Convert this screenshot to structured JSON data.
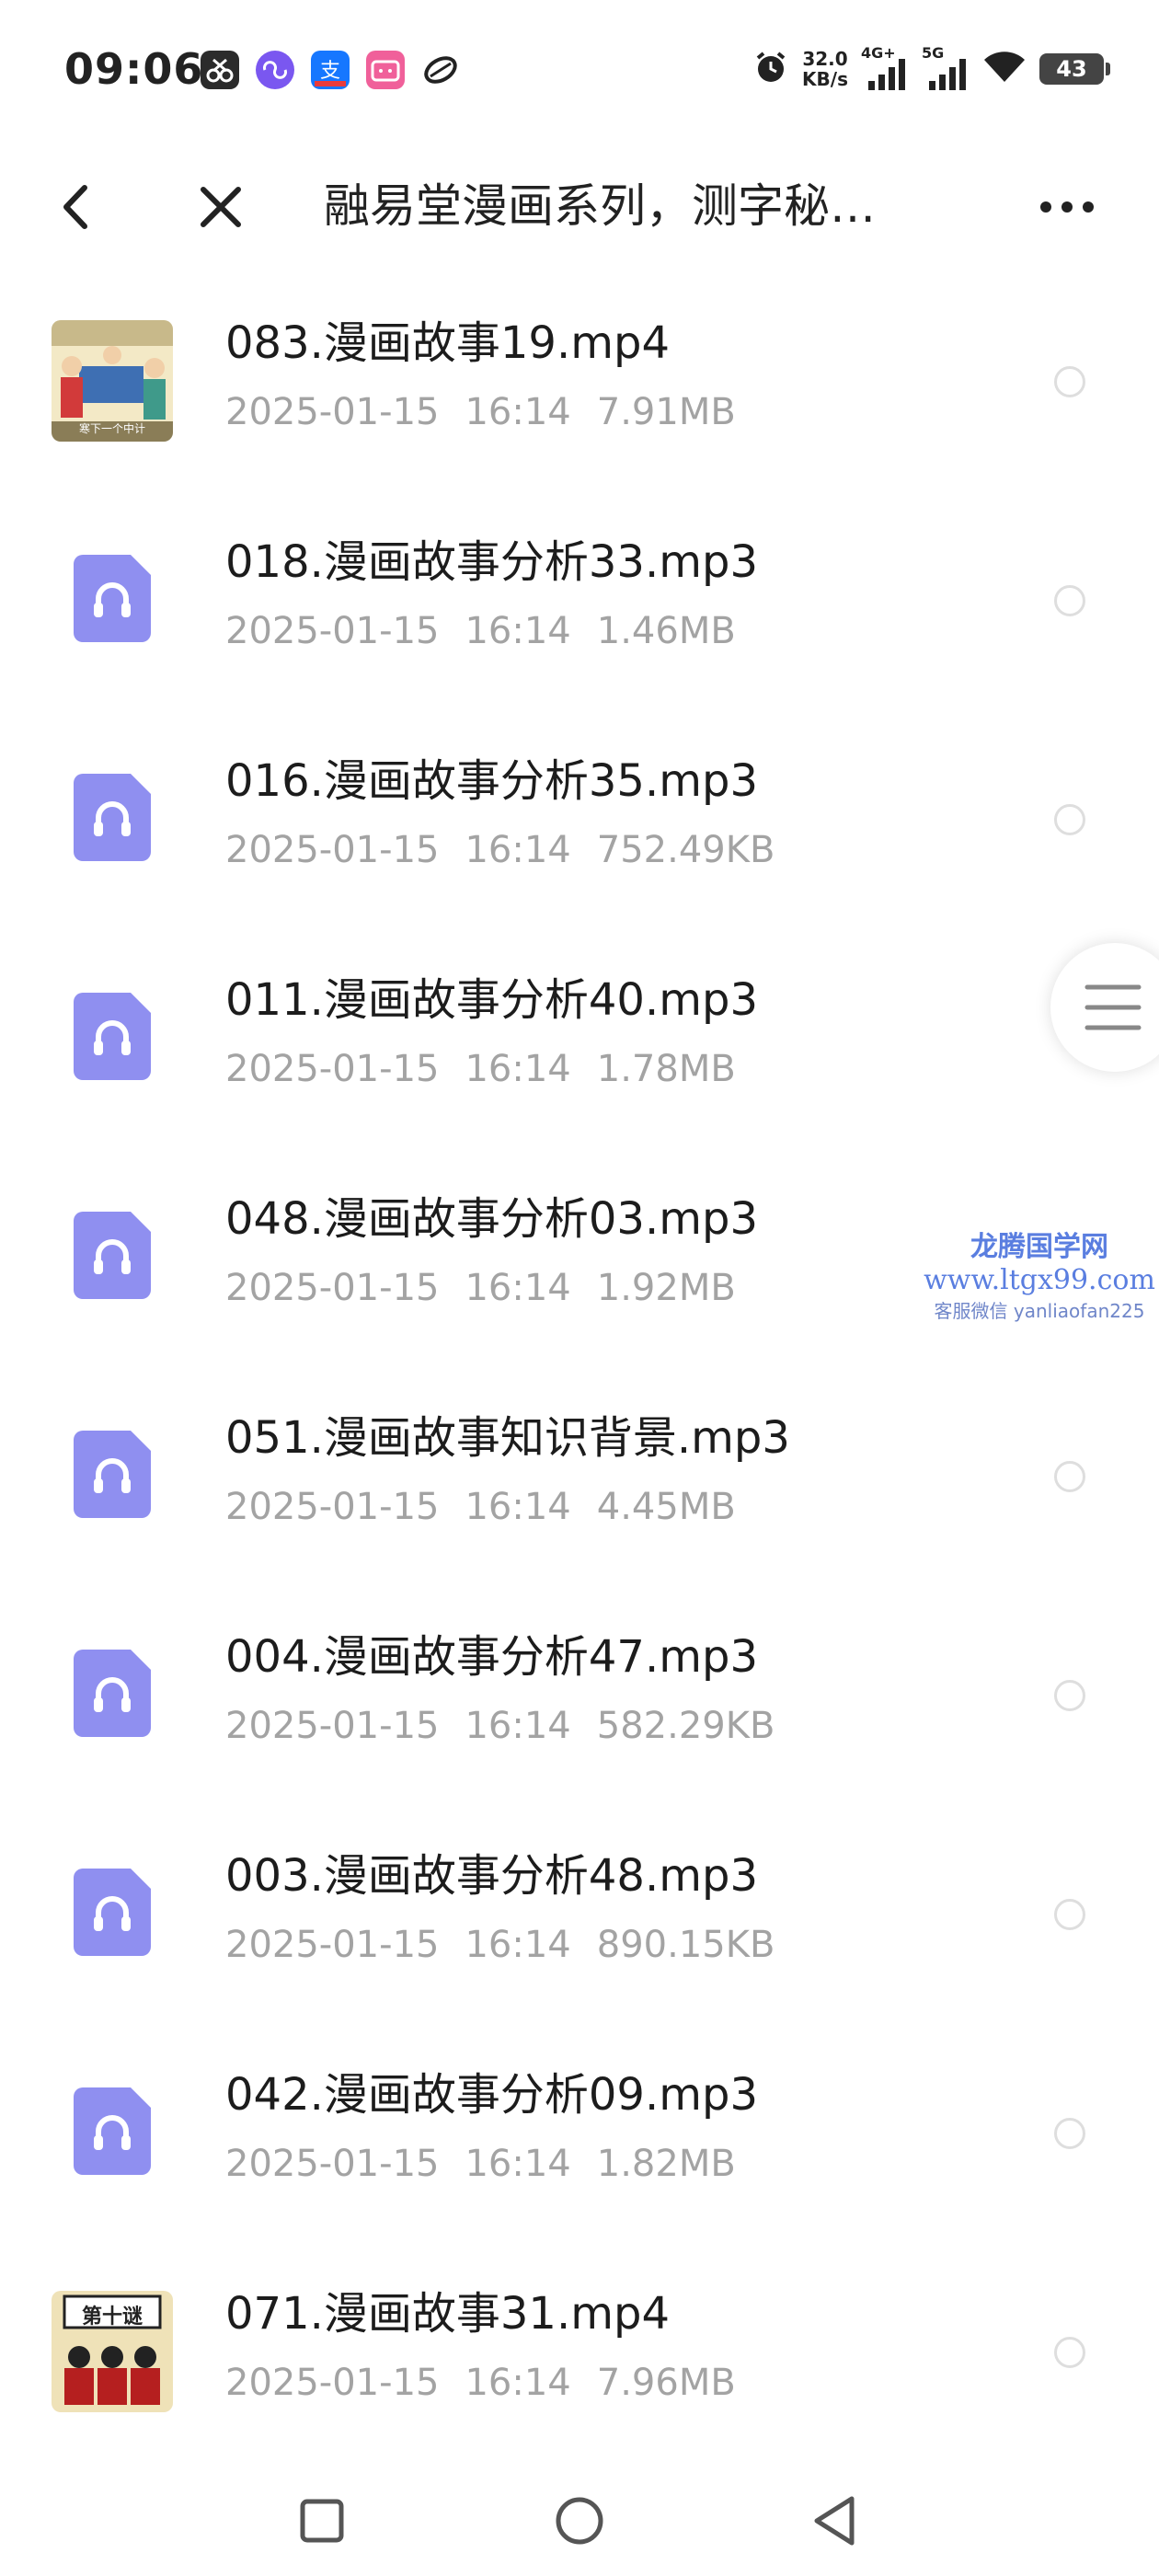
{
  "status_bar": {
    "time": "09:06",
    "net_speed_value": "32.0",
    "net_speed_unit": "KB/s",
    "signal1_label": "4G+",
    "signal2_label": "5G",
    "battery": "43",
    "apps": [
      "scissors-app-icon",
      "loop-app-icon",
      "alipay-app-icon",
      "bilibili-app-icon",
      "leaf-app-icon"
    ]
  },
  "header": {
    "title": "融易堂漫画系列，测字秘…"
  },
  "files": [
    {
      "name": "083.漫画故事19.mp4",
      "date": "2025-01-15",
      "time": "16:14",
      "size": "7.91MB",
      "type": "video",
      "thumb_caption": "寒下一个中计"
    },
    {
      "name": "018.漫画故事分析33.mp3",
      "date": "2025-01-15",
      "time": "16:14",
      "size": "1.46MB",
      "type": "audio"
    },
    {
      "name": "016.漫画故事分析35.mp3",
      "date": "2025-01-15",
      "time": "16:14",
      "size": "752.49KB",
      "type": "audio"
    },
    {
      "name": "011.漫画故事分析40.mp3",
      "date": "2025-01-15",
      "time": "16:14",
      "size": "1.78MB",
      "type": "audio"
    },
    {
      "name": "048.漫画故事分析03.mp3",
      "date": "2025-01-15",
      "time": "16:14",
      "size": "1.92MB",
      "type": "audio"
    },
    {
      "name": "051.漫画故事知识背景.mp3",
      "date": "2025-01-15",
      "time": "16:14",
      "size": "4.45MB",
      "type": "audio"
    },
    {
      "name": "004.漫画故事分析47.mp3",
      "date": "2025-01-15",
      "time": "16:14",
      "size": "582.29KB",
      "type": "audio"
    },
    {
      "name": "003.漫画故事分析48.mp3",
      "date": "2025-01-15",
      "time": "16:14",
      "size": "890.15KB",
      "type": "audio"
    },
    {
      "name": "042.漫画故事分析09.mp3",
      "date": "2025-01-15",
      "time": "16:14",
      "size": "1.82MB",
      "type": "audio"
    },
    {
      "name": "071.漫画故事31.mp4",
      "date": "2025-01-15",
      "time": "16:14",
      "size": "7.96MB",
      "type": "video",
      "thumb_caption": "第十谜"
    }
  ],
  "watermark": {
    "line1": "龙腾国学网",
    "line2": "www.ltgx99.com",
    "line3": "客服微信 yanliaofan225"
  },
  "colors": {
    "audio_icon": "#8f8ff0",
    "meta_text": "#a3a3a3",
    "watermark": "#5a7ee0"
  }
}
